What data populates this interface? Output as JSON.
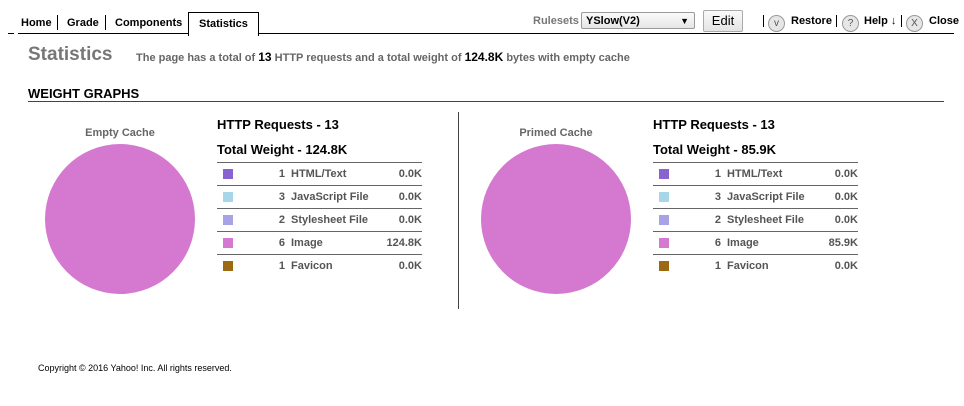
{
  "nav": {
    "tabs": [
      "Home",
      "Grade",
      "Components",
      "Statistics"
    ],
    "active_tab": "Statistics",
    "rulesets_label": "Rulesets",
    "ruleset_selected": "YSlow(V2)",
    "edit_label": "Edit",
    "restore_label": "Restore",
    "help_label": "Help ↓",
    "close_label": "Close",
    "restore_icon_glyph": "v",
    "help_icon_glyph": "?",
    "close_icon_glyph": "X"
  },
  "header": {
    "title": "Statistics",
    "summary_pre": "The page has a total of",
    "requests": "13",
    "summary_mid": "HTTP requests and a total weight of",
    "weight": "124.8K",
    "summary_post": "bytes with empty cache"
  },
  "section_title": "WEIGHT GRAPHS",
  "caches": [
    {
      "pie_label": "Empty Cache",
      "requests_label": "HTTP Requests - 13",
      "weight_label": "Total Weight - 124.8K",
      "rows": [
        {
          "count": "1",
          "type": "HTML/Text",
          "size": "0.0K",
          "color": "#8a63d2"
        },
        {
          "count": "3",
          "type": "JavaScript File",
          "size": "0.0K",
          "color": "#a6d6e8"
        },
        {
          "count": "2",
          "type": "Stylesheet File",
          "size": "0.0K",
          "color": "#a9a2e6"
        },
        {
          "count": "6",
          "type": "Image",
          "size": "124.8K",
          "color": "#d478d0"
        },
        {
          "count": "1",
          "type": "Favicon",
          "size": "0.0K",
          "color": "#9b6a12"
        }
      ]
    },
    {
      "pie_label": "Primed Cache",
      "requests_label": "HTTP Requests - 13",
      "weight_label": "Total Weight - 85.9K",
      "rows": [
        {
          "count": "1",
          "type": "HTML/Text",
          "size": "0.0K",
          "color": "#8a63d2"
        },
        {
          "count": "3",
          "type": "JavaScript File",
          "size": "0.0K",
          "color": "#a6d6e8"
        },
        {
          "count": "2",
          "type": "Stylesheet File",
          "size": "0.0K",
          "color": "#a9a2e6"
        },
        {
          "count": "6",
          "type": "Image",
          "size": "85.9K",
          "color": "#d478d0"
        },
        {
          "count": "1",
          "type": "Favicon",
          "size": "0.0K",
          "color": "#9b6a12"
        }
      ]
    }
  ],
  "copyright": "Copyright © 2016 Yahoo! Inc. All rights reserved."
}
